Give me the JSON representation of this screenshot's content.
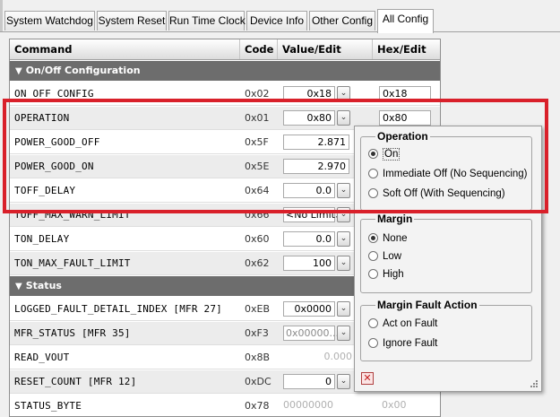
{
  "tabs": [
    {
      "label": "System Watchdog",
      "active": false
    },
    {
      "label": "System Reset",
      "active": false
    },
    {
      "label": "Run Time Clock",
      "active": false
    },
    {
      "label": "Device Info",
      "active": false
    },
    {
      "label": "Other Config",
      "active": false
    },
    {
      "label": "All Config",
      "active": true
    }
  ],
  "table": {
    "columns": {
      "command": "Command",
      "code": "Code",
      "value": "Value/Edit",
      "hex": "Hex/Edit"
    },
    "groups": [
      {
        "title": "On/Off Configuration",
        "rows": [
          {
            "name": "ON_OFF_CONFIG",
            "code": "0x02",
            "value": "0x18",
            "hex": "0x18"
          },
          {
            "name": "OPERATION",
            "code": "0x01",
            "value": "0x80",
            "hex": "0x80"
          },
          {
            "name": "POWER_GOOD_OFF",
            "code": "0x5F",
            "value": "2.871",
            "hex": ""
          },
          {
            "name": "POWER_GOOD_ON",
            "code": "0x5E",
            "value": "2.970",
            "hex": ""
          },
          {
            "name": "TOFF_DELAY",
            "code": "0x64",
            "value": "0.0",
            "hex": ""
          },
          {
            "name": "TOFF_MAX_WARN_LIMIT",
            "code": "0x66",
            "value": "<No Limit>",
            "hex": ""
          },
          {
            "name": "TON_DELAY",
            "code": "0x60",
            "value": "0.0",
            "hex": ""
          },
          {
            "name": "TON_MAX_FAULT_LIMIT",
            "code": "0x62",
            "value": "100",
            "hex": ""
          }
        ]
      },
      {
        "title": "Status",
        "rows": [
          {
            "name": "LOGGED_FAULT_DETAIL_INDEX [MFR 27]",
            "code": "0xEB",
            "value": "0x0000",
            "hex": ""
          },
          {
            "name": "MFR_STATUS [MFR 35]",
            "code": "0xF3",
            "value": "0x00000...",
            "hex": ""
          },
          {
            "name": "READ_VOUT",
            "code": "0x8B",
            "value": "0.000",
            "hex": ""
          },
          {
            "name": "RESET_COUNT [MFR 12]",
            "code": "0xDC",
            "value": "0",
            "hex": ""
          },
          {
            "name": "STATUS_BYTE",
            "code": "0x78",
            "value": "00000000",
            "hex": "0x00"
          }
        ]
      }
    ]
  },
  "popup": {
    "operation": {
      "title": "Operation",
      "options": [
        "On",
        "Immediate Off (No Sequencing)",
        "Soft Off (With Sequencing)"
      ],
      "selected": "On"
    },
    "margin": {
      "title": "Margin",
      "options": [
        "None",
        "Low",
        "High"
      ],
      "selected": "None"
    },
    "margin_fault_action": {
      "title": "Margin Fault Action",
      "options": [
        "Act on Fault",
        "Ignore Fault"
      ],
      "selected": ""
    },
    "close_icon": "close-icon"
  },
  "colors": {
    "highlight": "#d9202a",
    "group_header": "#6d6d6d"
  }
}
